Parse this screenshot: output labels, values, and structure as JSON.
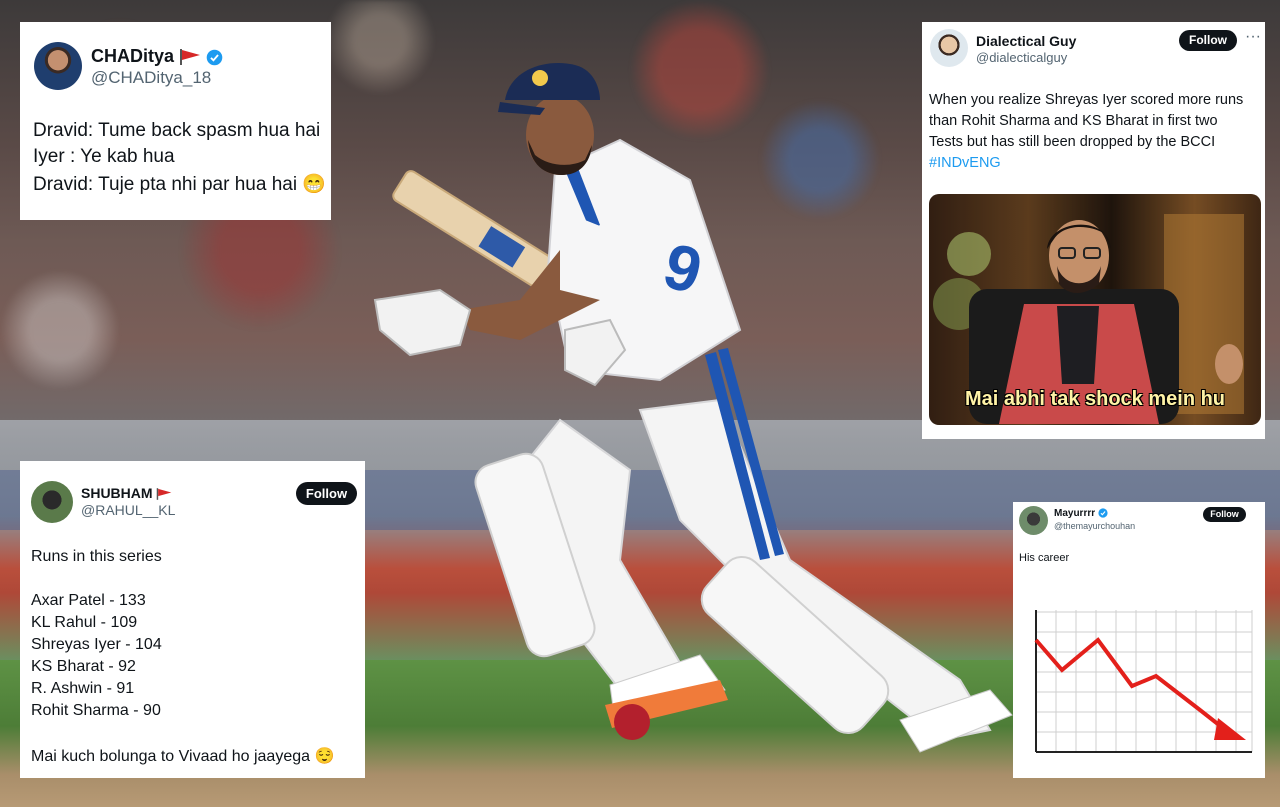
{
  "tweets": {
    "chaditya": {
      "name": "CHADitya",
      "handle": "@CHADitya_18",
      "lines": [
        "Dravid: Tume back spasm hua hai",
        "Iyer : Ye kab hua",
        "Dravid: Tuje pta nhi par hua hai 😁"
      ]
    },
    "dialectical": {
      "name": "Dialectical Guy",
      "handle": "@dialecticalguy",
      "follow": "Follow",
      "more": "···",
      "lines": [
        "When you realize Shreyas Iyer scored more runs",
        "than Rohit Sharma and KS Bharat in first two",
        "Tests but has still been dropped by the BCCI"
      ],
      "hashtag": "#INDvENG",
      "meme_caption": "Mai abhi tak shock mein hu"
    },
    "shubham": {
      "name": "SHUBHAM",
      "handle": "@RAHUL__KL",
      "follow": "Follow",
      "intro": "Runs in this series",
      "runs": [
        "Axar Patel - 133",
        "KL Rahul - 109",
        "Shreyas Iyer - 104",
        "KS Bharat - 92",
        "R. Ashwin - 91",
        "Rohit Sharma - 90"
      ],
      "outro": "Mai kuch bolunga to Vivaad ho jaayega 😌"
    },
    "mayur": {
      "name": "Mayurrrr",
      "handle": "@themayurchouhan",
      "follow": "Follow",
      "text": "His career"
    }
  },
  "colors": {
    "link": "#1d9bf0",
    "verified": "#1d9bf0",
    "flag": "#d62828",
    "graph_line": "#e3201b"
  },
  "icons": [
    "verified-icon",
    "flag-icon",
    "grin-emoji",
    "relieved-emoji",
    "more-icon"
  ]
}
